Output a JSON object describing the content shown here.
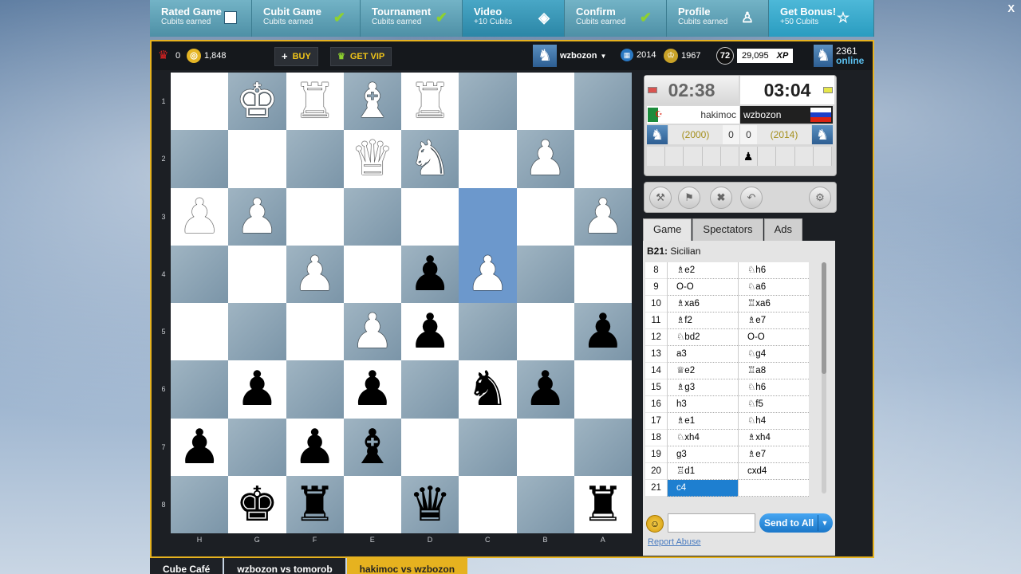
{
  "quests": [
    {
      "title": "Rated Game",
      "sub": "Cubits earned",
      "icon": "checkbox-icon"
    },
    {
      "title": "Cubit Game",
      "sub": "Cubits earned",
      "icon": "checkmark-icon"
    },
    {
      "title": "Tournament",
      "sub": "Cubits earned",
      "icon": "checkmark-icon"
    },
    {
      "title": "Video",
      "sub": "+10 Cubits",
      "icon": "ticket-icon"
    },
    {
      "title": "Confirm",
      "sub": "Cubits earned",
      "icon": "checkmark-icon"
    },
    {
      "title": "Profile",
      "sub": "Cubits earned",
      "icon": "person-icon"
    },
    {
      "title": "Get Bonus!",
      "sub": "+50 Cubits",
      "icon": "star-icon"
    }
  ],
  "quest_close": "X",
  "status": {
    "crowns": "0",
    "cubits": "1,848",
    "buy": "BUY",
    "get_vip": "GET VIP",
    "username": "wzbozon",
    "rating": "2014",
    "trophy": "1967",
    "level": "72",
    "xp": "29,095",
    "xp_label": "XP",
    "online_count": "2361",
    "online_label": "online"
  },
  "board": {
    "ranks": [
      "1",
      "2",
      "3",
      "4",
      "5",
      "6",
      "7",
      "8"
    ],
    "files": [
      "H",
      "G",
      "F",
      "E",
      "D",
      "C",
      "B",
      "A"
    ],
    "rows": [
      [
        "",
        "wK",
        "wR",
        "wB",
        "wR",
        "",
        "",
        ""
      ],
      [
        "",
        "",
        "",
        "wQ",
        "wN",
        "",
        "wP",
        ""
      ],
      [
        "wP",
        "wP",
        "",
        "",
        "",
        "",
        "",
        "wP"
      ],
      [
        "",
        "",
        "wP",
        "",
        "bP",
        "wP",
        "",
        ""
      ],
      [
        "",
        "",
        "",
        "wP",
        "bP",
        "",
        "",
        "bP"
      ],
      [
        "",
        "bP",
        "",
        "bP",
        "",
        "bN",
        "bP",
        ""
      ],
      [
        "bP",
        "",
        "bP",
        "bB",
        "",
        "",
        "",
        ""
      ],
      [
        "",
        "bK",
        "bR",
        "",
        "bQ",
        "",
        "",
        "bR"
      ]
    ]
  },
  "clocks": {
    "white_time": "02:38",
    "black_time": "03:04",
    "white_name": "hakimoc",
    "black_name": "wzbozon",
    "white_rating": "(2000)",
    "black_rating": "(2014)",
    "white_score": "0",
    "black_score": "0"
  },
  "tabs": [
    "Game",
    "Spectators",
    "Ads"
  ],
  "opening_code": "B21:",
  "opening_name": "Sicilian",
  "moves": [
    {
      "n": "8",
      "w": "♗e2",
      "b": "♘h6"
    },
    {
      "n": "9",
      "w": "O-O",
      "b": "♘a6"
    },
    {
      "n": "10",
      "w": "♗xa6",
      "b": "♖xa6"
    },
    {
      "n": "11",
      "w": "♗f2",
      "b": "♗e7"
    },
    {
      "n": "12",
      "w": "♘bd2",
      "b": "O-O"
    },
    {
      "n": "13",
      "w": "a3",
      "b": "♘g4"
    },
    {
      "n": "14",
      "w": "♕e2",
      "b": "♖a8"
    },
    {
      "n": "15",
      "w": "♗g3",
      "b": "♘h6"
    },
    {
      "n": "16",
      "w": "h3",
      "b": "♘f5"
    },
    {
      "n": "17",
      "w": "♗e1",
      "b": "♘h4"
    },
    {
      "n": "18",
      "w": "♘xh4",
      "b": "♗xh4"
    },
    {
      "n": "19",
      "w": "g3",
      "b": "♗e7"
    },
    {
      "n": "20",
      "w": "♖d1",
      "b": "cxd4"
    },
    {
      "n": "21",
      "w": "c4",
      "b": ""
    }
  ],
  "chat": {
    "send": "Send to All",
    "report": "Report Abuse"
  },
  "bottom_tabs": [
    "Cube Café",
    "wzbozon vs tomorob",
    "hakimoc vs wzbozon"
  ]
}
